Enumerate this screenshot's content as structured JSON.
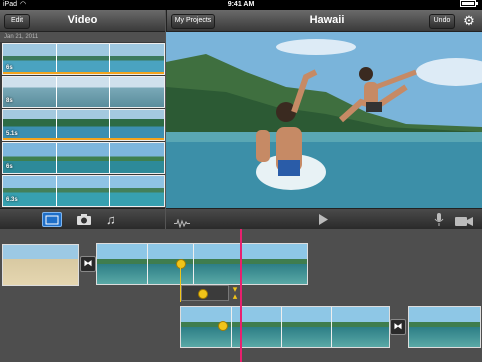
{
  "status_bar": {
    "device": "iPad",
    "time": "9:41 AM"
  },
  "left_bar": {
    "edit_label": "Edit",
    "title": "Video"
  },
  "right_bar": {
    "my_projects_label": "My Projects",
    "title": "Hawaii",
    "undo_label": "Undo"
  },
  "browser": {
    "date_header": "Jan 21, 2011",
    "clips": [
      {
        "duration": "6s"
      },
      {
        "duration": "8s"
      },
      {
        "duration": "5.1s"
      },
      {
        "duration": "6s"
      },
      {
        "duration": "6.3s"
      }
    ]
  },
  "media_tabs": [
    {
      "name": "video-tab-icon",
      "selected": true
    },
    {
      "name": "photo-tab-icon",
      "selected": false
    },
    {
      "name": "music-tab-icon",
      "selected": false
    }
  ],
  "colors": {
    "accent": "#f0c419",
    "playhead": "#e8206e",
    "used_marker": "#f3a31d"
  }
}
